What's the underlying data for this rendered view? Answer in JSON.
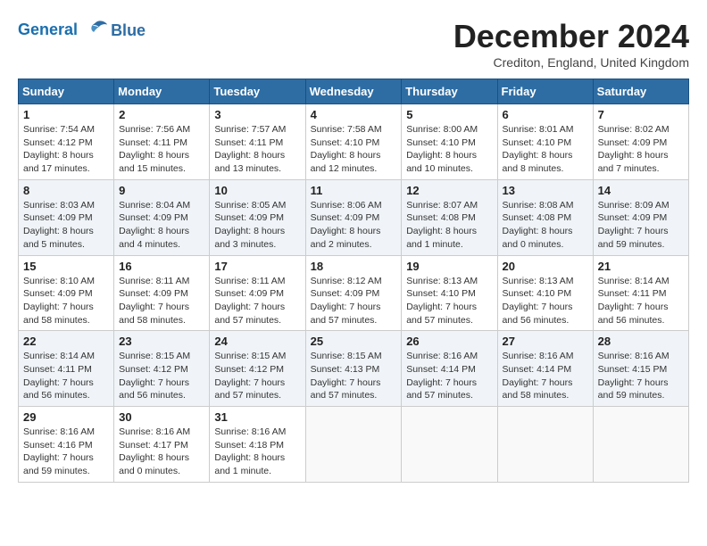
{
  "header": {
    "logo_line1": "General",
    "logo_line2": "Blue",
    "month_title": "December 2024",
    "subtitle": "Crediton, England, United Kingdom"
  },
  "weekdays": [
    "Sunday",
    "Monday",
    "Tuesday",
    "Wednesday",
    "Thursday",
    "Friday",
    "Saturday"
  ],
  "weeks": [
    [
      {
        "day": "1",
        "sunrise": "7:54 AM",
        "sunset": "4:12 PM",
        "daylight": "8 hours and 17 minutes."
      },
      {
        "day": "2",
        "sunrise": "7:56 AM",
        "sunset": "4:11 PM",
        "daylight": "8 hours and 15 minutes."
      },
      {
        "day": "3",
        "sunrise": "7:57 AM",
        "sunset": "4:11 PM",
        "daylight": "8 hours and 13 minutes."
      },
      {
        "day": "4",
        "sunrise": "7:58 AM",
        "sunset": "4:10 PM",
        "daylight": "8 hours and 12 minutes."
      },
      {
        "day": "5",
        "sunrise": "8:00 AM",
        "sunset": "4:10 PM",
        "daylight": "8 hours and 10 minutes."
      },
      {
        "day": "6",
        "sunrise": "8:01 AM",
        "sunset": "4:10 PM",
        "daylight": "8 hours and 8 minutes."
      },
      {
        "day": "7",
        "sunrise": "8:02 AM",
        "sunset": "4:09 PM",
        "daylight": "8 hours and 7 minutes."
      }
    ],
    [
      {
        "day": "8",
        "sunrise": "8:03 AM",
        "sunset": "4:09 PM",
        "daylight": "8 hours and 5 minutes."
      },
      {
        "day": "9",
        "sunrise": "8:04 AM",
        "sunset": "4:09 PM",
        "daylight": "8 hours and 4 minutes."
      },
      {
        "day": "10",
        "sunrise": "8:05 AM",
        "sunset": "4:09 PM",
        "daylight": "8 hours and 3 minutes."
      },
      {
        "day": "11",
        "sunrise": "8:06 AM",
        "sunset": "4:09 PM",
        "daylight": "8 hours and 2 minutes."
      },
      {
        "day": "12",
        "sunrise": "8:07 AM",
        "sunset": "4:08 PM",
        "daylight": "8 hours and 1 minute."
      },
      {
        "day": "13",
        "sunrise": "8:08 AM",
        "sunset": "4:08 PM",
        "daylight": "8 hours and 0 minutes."
      },
      {
        "day": "14",
        "sunrise": "8:09 AM",
        "sunset": "4:09 PM",
        "daylight": "7 hours and 59 minutes."
      }
    ],
    [
      {
        "day": "15",
        "sunrise": "8:10 AM",
        "sunset": "4:09 PM",
        "daylight": "7 hours and 58 minutes."
      },
      {
        "day": "16",
        "sunrise": "8:11 AM",
        "sunset": "4:09 PM",
        "daylight": "7 hours and 58 minutes."
      },
      {
        "day": "17",
        "sunrise": "8:11 AM",
        "sunset": "4:09 PM",
        "daylight": "7 hours and 57 minutes."
      },
      {
        "day": "18",
        "sunrise": "8:12 AM",
        "sunset": "4:09 PM",
        "daylight": "7 hours and 57 minutes."
      },
      {
        "day": "19",
        "sunrise": "8:13 AM",
        "sunset": "4:10 PM",
        "daylight": "7 hours and 57 minutes."
      },
      {
        "day": "20",
        "sunrise": "8:13 AM",
        "sunset": "4:10 PM",
        "daylight": "7 hours and 56 minutes."
      },
      {
        "day": "21",
        "sunrise": "8:14 AM",
        "sunset": "4:11 PM",
        "daylight": "7 hours and 56 minutes."
      }
    ],
    [
      {
        "day": "22",
        "sunrise": "8:14 AM",
        "sunset": "4:11 PM",
        "daylight": "7 hours and 56 minutes."
      },
      {
        "day": "23",
        "sunrise": "8:15 AM",
        "sunset": "4:12 PM",
        "daylight": "7 hours and 56 minutes."
      },
      {
        "day": "24",
        "sunrise": "8:15 AM",
        "sunset": "4:12 PM",
        "daylight": "7 hours and 57 minutes."
      },
      {
        "day": "25",
        "sunrise": "8:15 AM",
        "sunset": "4:13 PM",
        "daylight": "7 hours and 57 minutes."
      },
      {
        "day": "26",
        "sunrise": "8:16 AM",
        "sunset": "4:14 PM",
        "daylight": "7 hours and 57 minutes."
      },
      {
        "day": "27",
        "sunrise": "8:16 AM",
        "sunset": "4:14 PM",
        "daylight": "7 hours and 58 minutes."
      },
      {
        "day": "28",
        "sunrise": "8:16 AM",
        "sunset": "4:15 PM",
        "daylight": "7 hours and 59 minutes."
      }
    ],
    [
      {
        "day": "29",
        "sunrise": "8:16 AM",
        "sunset": "4:16 PM",
        "daylight": "7 hours and 59 minutes."
      },
      {
        "day": "30",
        "sunrise": "8:16 AM",
        "sunset": "4:17 PM",
        "daylight": "8 hours and 0 minutes."
      },
      {
        "day": "31",
        "sunrise": "8:16 AM",
        "sunset": "4:18 PM",
        "daylight": "8 hours and 1 minute."
      },
      null,
      null,
      null,
      null
    ]
  ]
}
